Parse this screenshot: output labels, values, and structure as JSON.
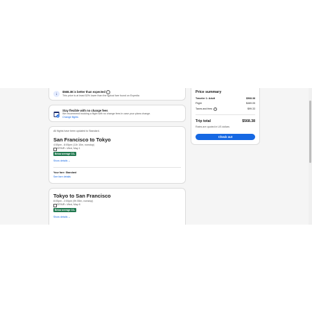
{
  "deal_card": {
    "title": "$568.38 is better than expected",
    "subtitle": "This price is at least 52% lower than the typical fare found on Expedia"
  },
  "flexible_card": {
    "title": "Stay flexible with no change fees",
    "subtitle": "We recommend booking a flight with no change fees in case your plans change.",
    "link": "Change flights"
  },
  "flights_card": {
    "notice": "All flights have been updated to Standard.",
    "outbound": {
      "route": "San Francisco to Tokyo",
      "times": "4:55pm - 8:05pm (11h 10m, nonstop)",
      "carrier": "ZIPAIR • Wed, May 1",
      "badge": "Below average CO₂",
      "details": "Show details"
    },
    "fare_label": "Your fare: Standard",
    "fare_link": "See fare details"
  },
  "return_card": {
    "route": "Tokyo to San Francisco",
    "times": "8:05pm - 2:00pm (9h 55m, nonstop)",
    "carrier": "ZIPAIR • Wed, May 8",
    "badge": "Below average CO₂",
    "details": "Show details"
  },
  "price_summary": {
    "title": "Price summary",
    "traveler_label": "Traveler 1: Adult",
    "traveler_value": "$568.38",
    "flight_label": "Flight",
    "flight_value": "$469.05",
    "taxes_label": "Taxes and fees",
    "taxes_value": "$99.33",
    "total_label": "Trip total",
    "total_value": "$568.38",
    "note": "Rates are quoted in US dollars",
    "button": "Check out"
  }
}
